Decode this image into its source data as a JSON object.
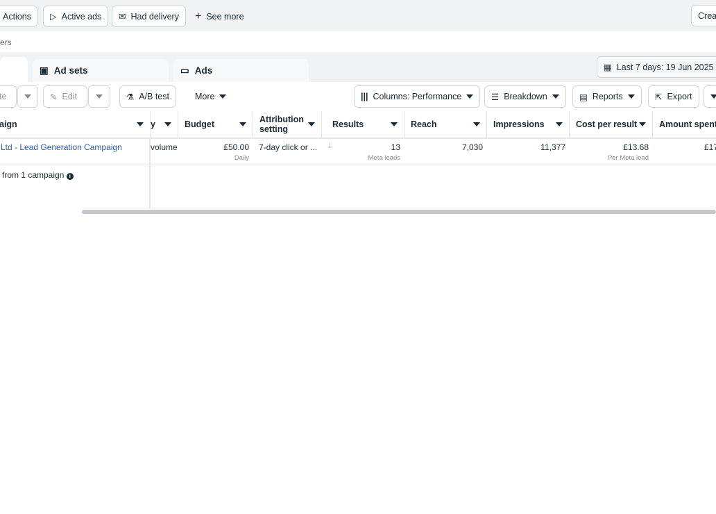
{
  "filters": {
    "actions": "Actions",
    "active_ads": "Active ads",
    "had_delivery": "Had delivery",
    "see_more": "See more",
    "create": "Crea",
    "filter_text": "ers"
  },
  "tabs": {
    "ad_sets": "Ad sets",
    "ads": "Ads"
  },
  "date_range": "Last 7 days: 19 Jun 2025 -",
  "toolbar": {
    "duplicate": "te",
    "edit": "Edit",
    "ab_test": "A/B test",
    "more": "More",
    "columns": "Columns: Performance",
    "breakdown": "Breakdown",
    "reports": "Reports",
    "export": "Export"
  },
  "table": {
    "headers": {
      "campaign": "aign",
      "strategy": "y",
      "budget": "Budget",
      "attribution": "Attribution setting",
      "results": "Results",
      "reach": "Reach",
      "impressions": "Impressions",
      "cost_per_result": "Cost per result",
      "amount_spent": "Amount spent"
    },
    "row": {
      "campaign": "Ltd - Lead Generation Campaign",
      "strategy": "volume",
      "budget": "£50.00",
      "budget_sub": "Daily",
      "attribution": "7-day click or ...",
      "results": "13",
      "results_sub": "Meta leads",
      "reach": "7,030",
      "impressions": "11,377",
      "cost_per_result": "£13.68",
      "cost_sub": "Per Meta lead",
      "amount_spent": "£17"
    },
    "summary": "from 1 campaign"
  }
}
